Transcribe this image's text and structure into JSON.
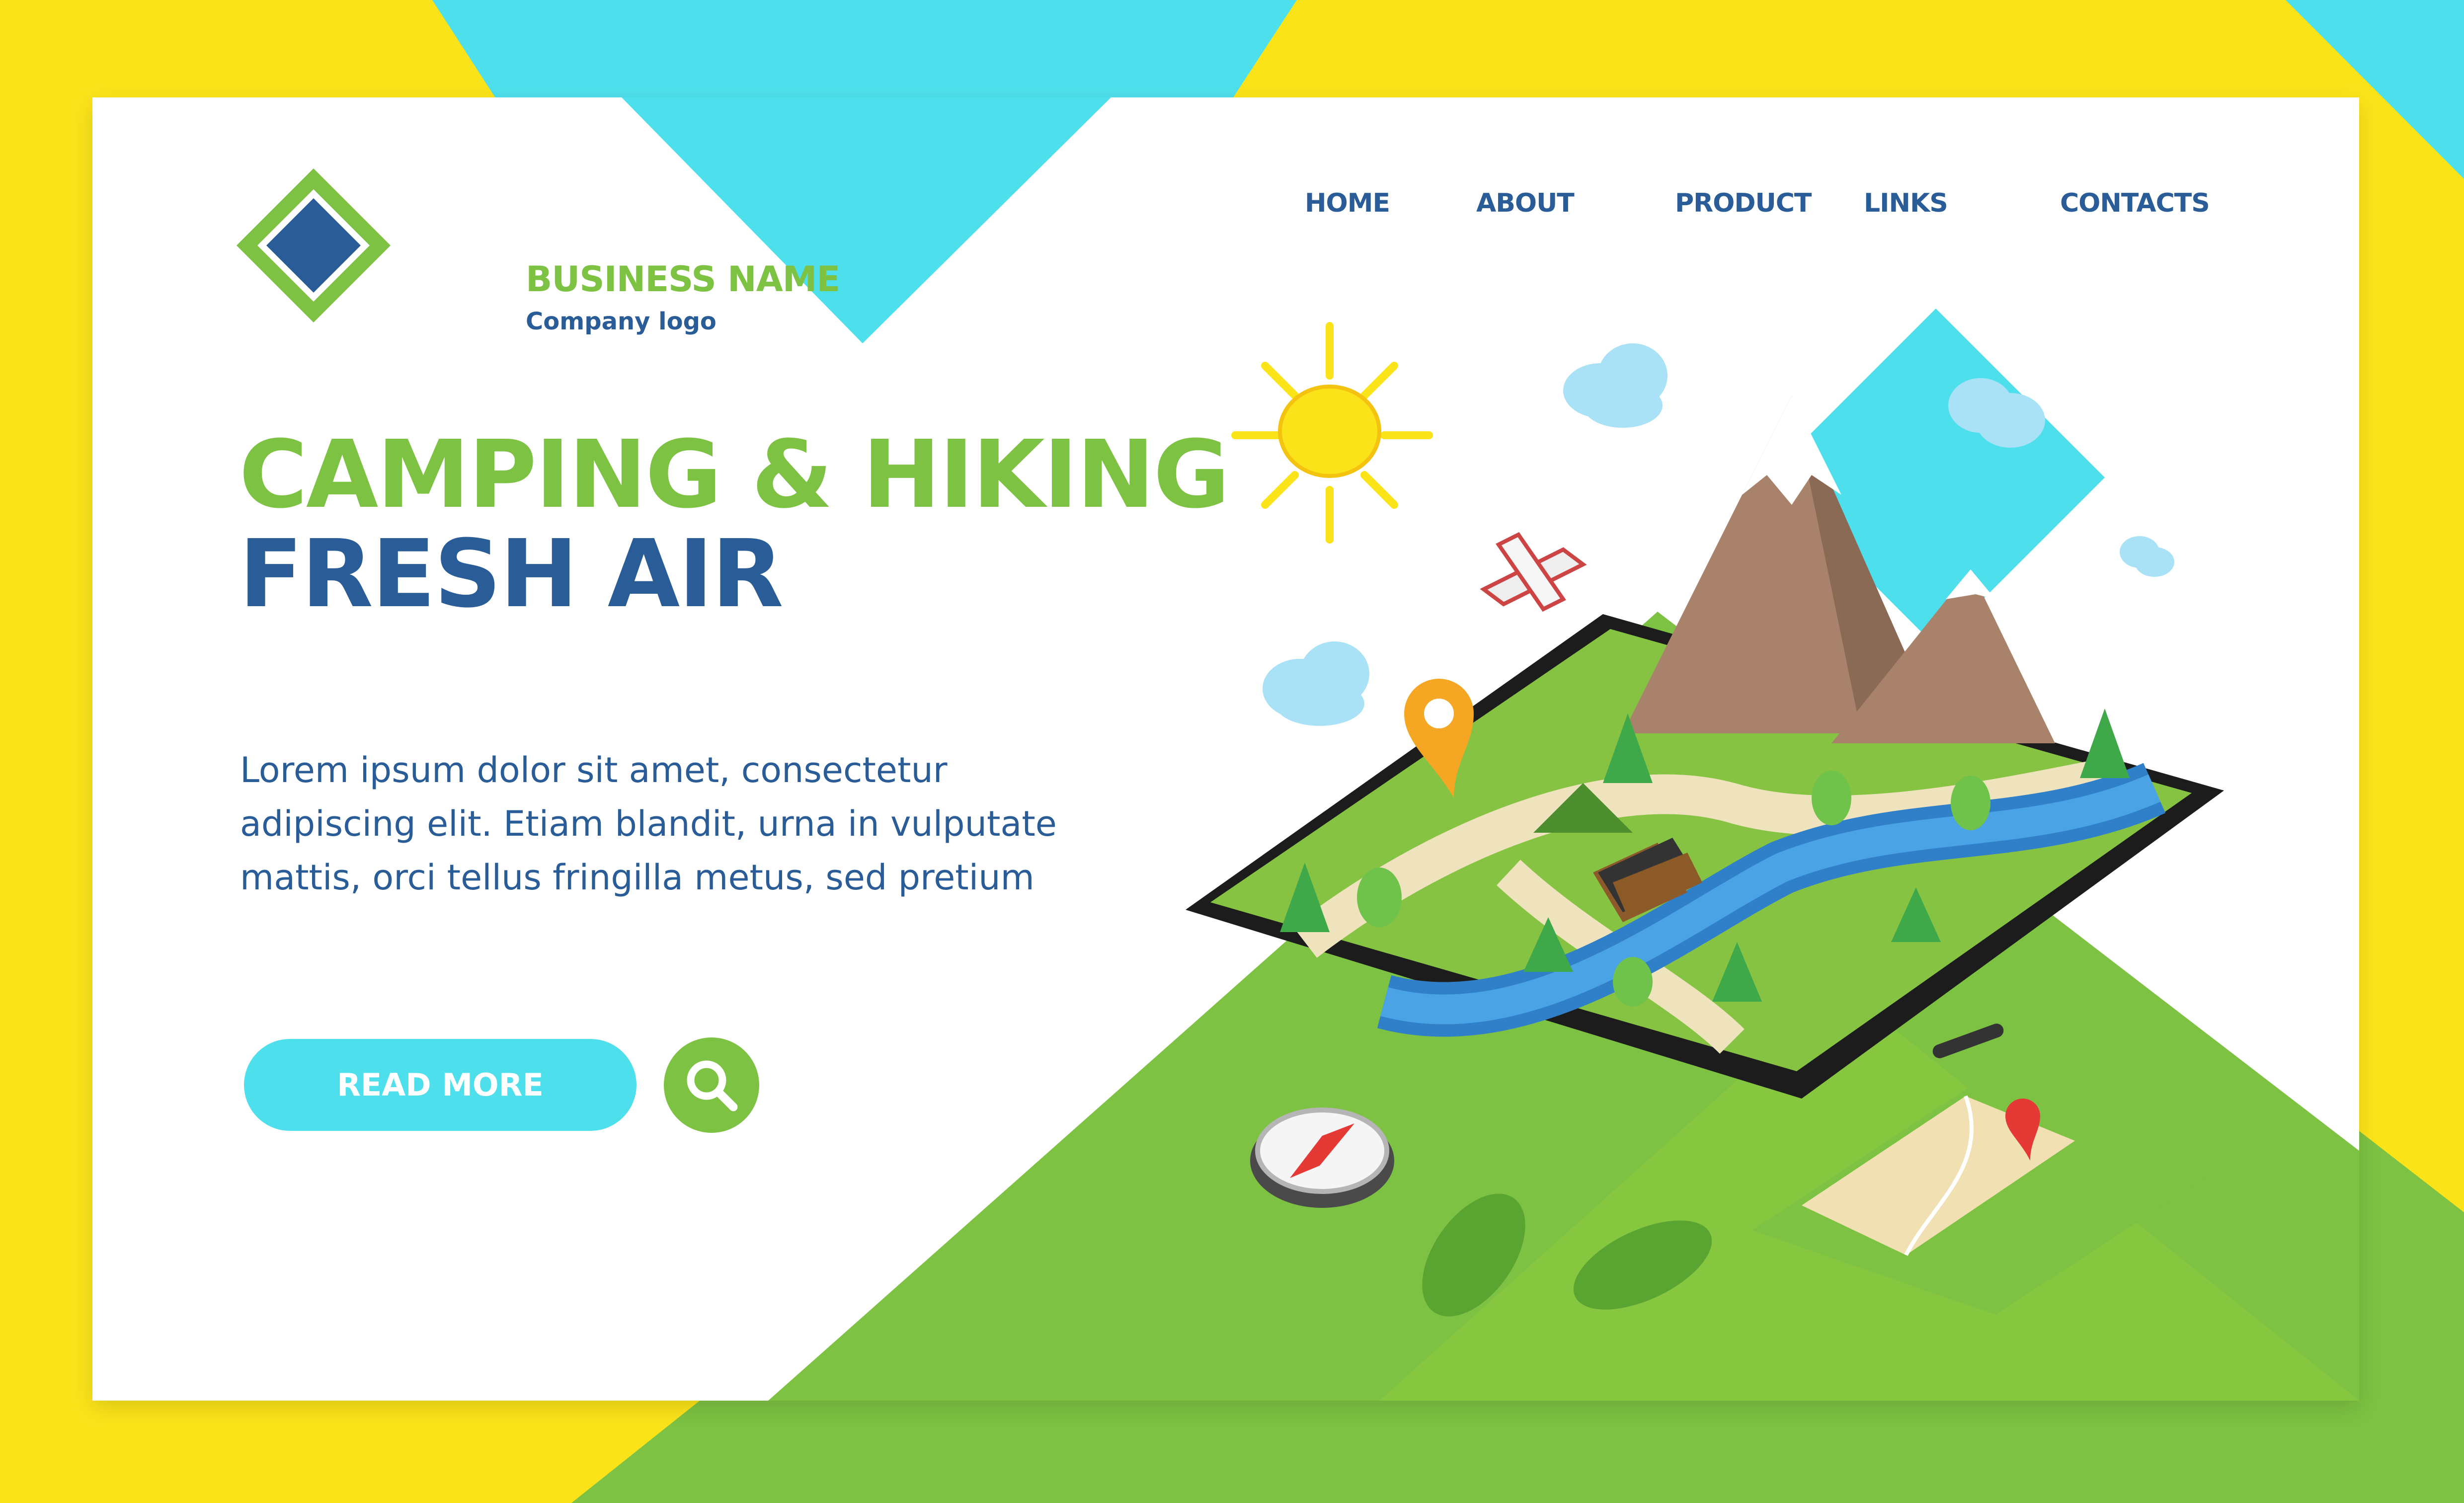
{
  "logo": {
    "name": "BUSINESS NAME",
    "tagline": "Company logo"
  },
  "nav": {
    "items": [
      {
        "label": "HOME"
      },
      {
        "label": "ABOUT"
      },
      {
        "label": "PRODUCT"
      },
      {
        "label": "LINKS"
      },
      {
        "label": "CONTACTS"
      }
    ]
  },
  "hero": {
    "headline": "CAMPING & HIKING",
    "subheadline": "FRESH AIR",
    "body_lines": [
      "Lorem ipsum dolor sit amet, consectetur",
      "adipiscing elit. Etiam blandit, urna in vulputate",
      "mattis, orci tellus fringilla metus, sed pretium"
    ],
    "cta_label": "READ MORE"
  },
  "icons": {
    "search": "search-icon",
    "logo_mark": "diamond-logo-icon"
  },
  "colors": {
    "frame_yellow": "#fbe31a",
    "accent_cyan": "#4de0ec",
    "brand_green": "#7dc242",
    "brand_blue": "#2a5d97",
    "background": "#ffffff"
  }
}
